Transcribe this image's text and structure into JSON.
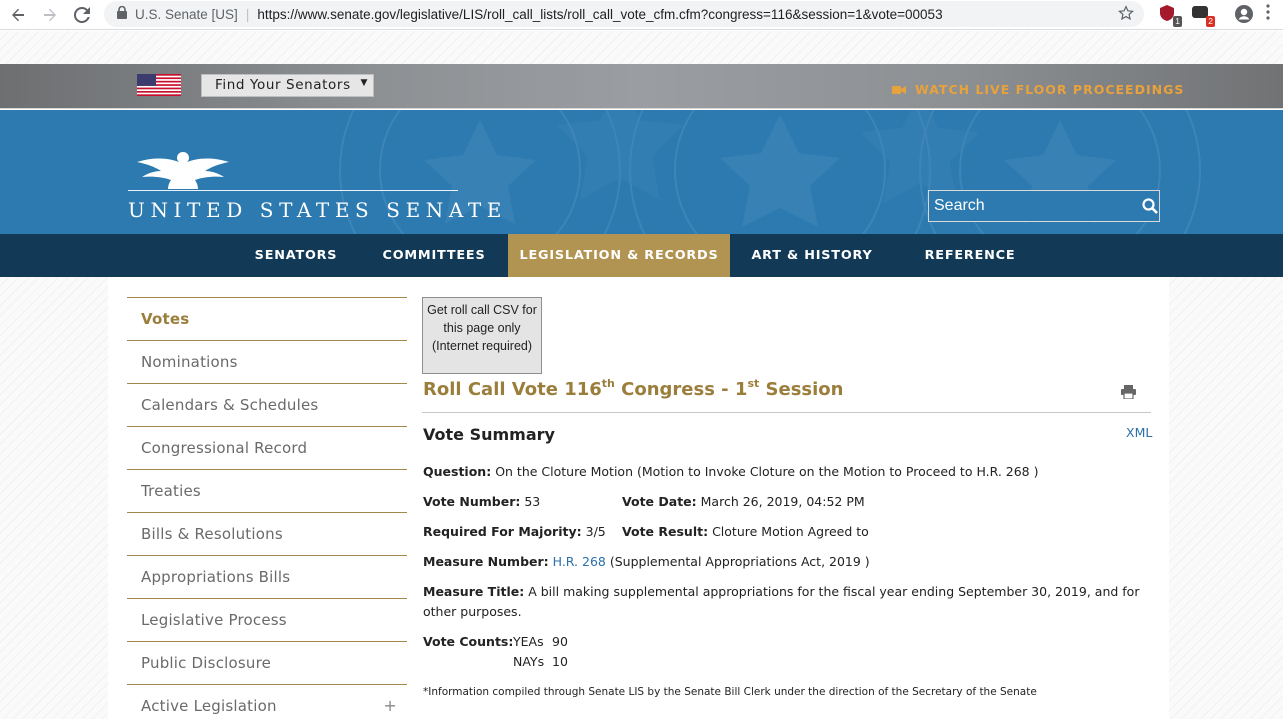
{
  "browser": {
    "site_label": "U.S. Senate [US]",
    "url": "https://www.senate.gov/legislative/LIS/roll_call_lists/roll_call_vote_cfm.cfm?congress=116&session=1&vote=00053",
    "ext_badge_1": "1",
    "ext_badge_2": "2"
  },
  "utility": {
    "find_senators": "Find Your Senators",
    "watch_live": "WATCH LIVE FLOOR PROCEEDINGS"
  },
  "header": {
    "site_title": "UNITED STATES SENATE",
    "search_placeholder": "Search"
  },
  "nav": {
    "items": [
      {
        "label": "SENATORS"
      },
      {
        "label": "COMMITTEES"
      },
      {
        "label": "LEGISLATION & RECORDS"
      },
      {
        "label": "ART & HISTORY"
      },
      {
        "label": "REFERENCE"
      }
    ]
  },
  "sidebar": {
    "items": [
      {
        "label": "Votes"
      },
      {
        "label": "Nominations"
      },
      {
        "label": "Calendars & Schedules"
      },
      {
        "label": "Congressional Record"
      },
      {
        "label": "Treaties"
      },
      {
        "label": "Bills & Resolutions"
      },
      {
        "label": "Appropriations Bills"
      },
      {
        "label": "Legislative Process"
      },
      {
        "label": "Public Disclosure"
      },
      {
        "label": "Active Legislation"
      }
    ],
    "expand_symbol": "+"
  },
  "main": {
    "csv_button": "Get roll call CSV for this page only (Internet required)",
    "title_prefix": "Roll Call Vote 116",
    "title_sup1": "th",
    "title_mid": " Congress - 1",
    "title_sup2": "st",
    "title_suffix": " Session",
    "summary_heading": "Vote Summary",
    "xml_link": "XML",
    "question_label": "Question:",
    "question_value": "On the Cloture Motion (Motion to Invoke Cloture on the Motion to Proceed to H.R. 268 )",
    "vote_number_label": "Vote Number:",
    "vote_number_value": "53",
    "vote_date_label": "Vote Date:",
    "vote_date_value": "March 26, 2019, 04:52 PM",
    "required_label": "Required For Majority:",
    "required_value": "3/5",
    "result_label": "Vote Result:",
    "result_value": "Cloture Motion Agreed to",
    "measure_number_label": "Measure Number:",
    "measure_number_link": "H.R. 268",
    "measure_number_rest": "(Supplemental Appropriations Act, 2019 )",
    "measure_title_label": "Measure Title:",
    "measure_title_value": "A bill making supplemental appropriations for the fiscal year ending September 30, 2019, and for other purposes.",
    "vote_counts_label": "Vote Counts:",
    "yeas_label": "YEAs",
    "yeas_value": "90",
    "nays_label": "NAYs",
    "nays_value": "10",
    "footnote": "*Information compiled through Senate LIS by the Senate Bill Clerk under the direction of the Secretary of the Senate"
  },
  "colors": {
    "header_blue": "#2c7ab0",
    "nav_dark": "#123a56",
    "gold": "#b29452",
    "watch_live": "#e8a23c"
  },
  "icons": [
    "back-icon",
    "forward-icon",
    "reload-icon",
    "lock-icon",
    "star-icon",
    "camera-icon",
    "search-icon",
    "print-icon",
    "flag-icon",
    "eagle-icon"
  ]
}
